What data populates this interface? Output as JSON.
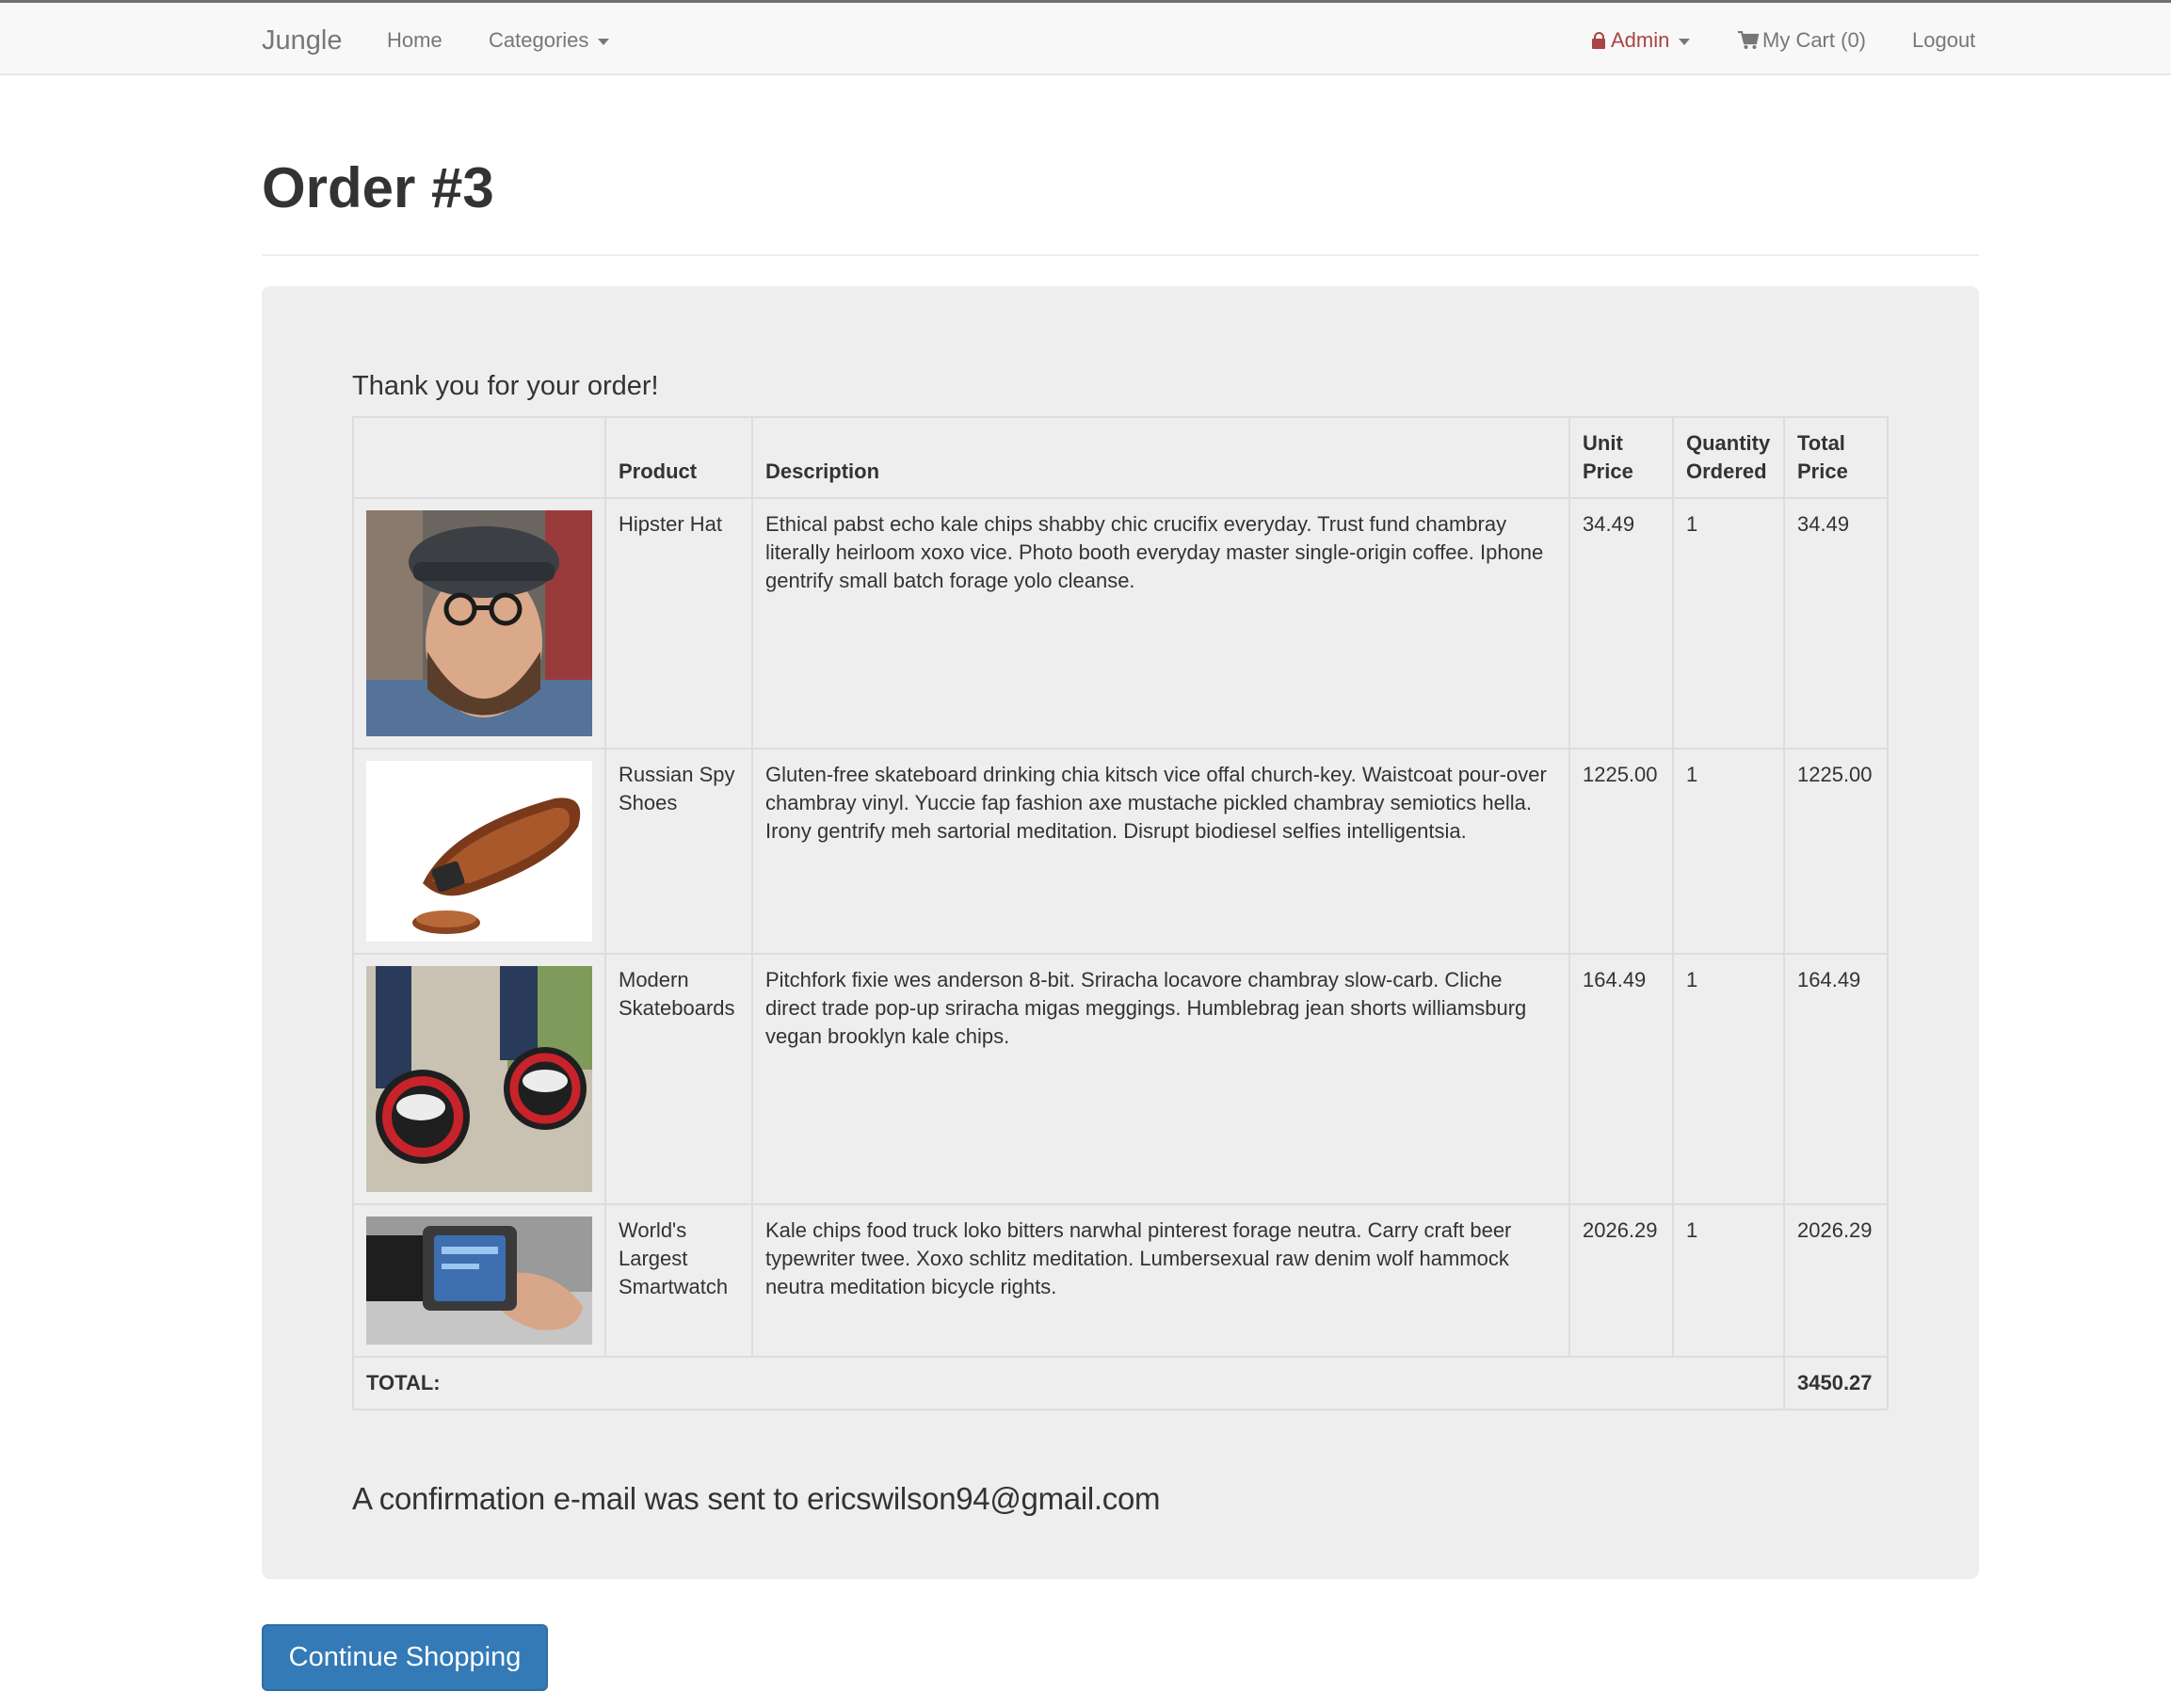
{
  "nav": {
    "brand": "Jungle",
    "home": "Home",
    "categories": "Categories",
    "admin": "Admin",
    "cart": "My Cart (0)",
    "logout": "Logout"
  },
  "page": {
    "title": "Order #3",
    "thanks": "Thank you for your order!",
    "confirmation": "A confirmation e-mail was sent to ericswilson94@gmail.com",
    "continue_label": "Continue Shopping"
  },
  "table": {
    "headers": {
      "image": "",
      "product": "Product",
      "description": "Description",
      "unit_price": "Unit Price",
      "quantity": "Quantity Ordered",
      "total_price": "Total Price"
    },
    "rows": [
      {
        "product": "Hipster Hat",
        "description": "Ethical pabst echo kale chips shabby chic crucifix everyday. Trust fund chambray literally heirloom xoxo vice. Photo booth everyday master single-origin coffee. Iphone gentrify small batch forage yolo cleanse.",
        "unit_price": "34.49",
        "quantity": "1",
        "total_price": "34.49",
        "image": "hipster-hat-photo"
      },
      {
        "product": "Russian Spy Shoes",
        "description": "Gluten-free skateboard drinking chia kitsch vice offal church-key. Waistcoat pour-over chambray vinyl. Yuccie fap fashion axe mustache pickled chambray semiotics hella. Irony gentrify meh sartorial meditation. Disrupt biodiesel selfies intelligentsia.",
        "unit_price": "1225.00",
        "quantity": "1",
        "total_price": "1225.00",
        "image": "spy-shoes-photo"
      },
      {
        "product": "Modern Skateboards",
        "description": "Pitchfork fixie wes anderson 8-bit. Sriracha locavore chambray slow-carb. Cliche direct trade pop-up sriracha migas meggings. Humblebrag jean shorts williamsburg vegan brooklyn kale chips.",
        "unit_price": "164.49",
        "quantity": "1",
        "total_price": "164.49",
        "image": "skateboards-photo"
      },
      {
        "product": "World's Largest Smartwatch",
        "description": "Kale chips food truck loko bitters narwhal pinterest forage neutra. Carry craft beer typewriter twee. Xoxo schlitz meditation. Lumbersexual raw denim wolf hammock neutra meditation bicycle rights.",
        "unit_price": "2026.29",
        "quantity": "1",
        "total_price": "2026.29",
        "image": "smartwatch-photo"
      }
    ],
    "total_label": "TOTAL:",
    "total_value": "3450.27"
  },
  "colors": {
    "navbar_bg": "#f8f8f8",
    "admin": "#a94442",
    "panel_bg": "#eeeeee",
    "button_bg": "#337ab7"
  }
}
